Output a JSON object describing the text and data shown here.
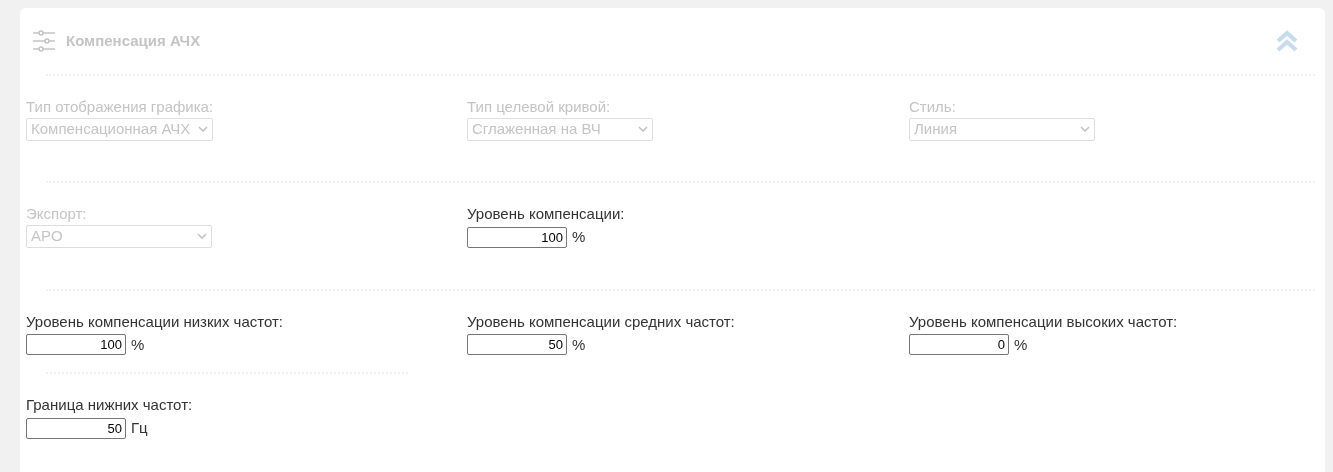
{
  "panel": {
    "title": "Компенсация АЧХ",
    "expanded": true
  },
  "rows": [
    {
      "full_divider": true,
      "fields": [
        {
          "kind": "select",
          "label": "Тип отображения графика:",
          "value": "Компенсационная АЧХ",
          "disabled": true
        },
        {
          "kind": "select",
          "label": "Тип целевой кривой:",
          "value": "Сглаженная на ВЧ",
          "disabled": true
        },
        {
          "kind": "select",
          "label": "Стиль:",
          "value": "Линия",
          "disabled": true
        }
      ]
    },
    {
      "full_divider": true,
      "fields": [
        {
          "kind": "select",
          "label": "Экспорт:",
          "value": "APO",
          "disabled": true
        },
        {
          "kind": "number",
          "label": "Уровень компенсации:",
          "value": "100",
          "unit": "%",
          "disabled": false
        }
      ]
    },
    {
      "full_divider": true,
      "fields": [
        {
          "kind": "number",
          "label": "Уровень компенсации низких частот:",
          "value": "100",
          "unit": "%",
          "disabled": false
        },
        {
          "kind": "number",
          "label": "Уровень компенсации средних частот:",
          "value": "50",
          "unit": "%",
          "disabled": false
        },
        {
          "kind": "number",
          "label": "Уровень компенсации высоких частот:",
          "value": "0",
          "unit": "%",
          "disabled": false
        }
      ]
    },
    {
      "full_divider": false,
      "fields": [
        {
          "kind": "number",
          "label": "Граница нижних частот:",
          "value": "50",
          "unit": "Гц",
          "disabled": false
        }
      ]
    }
  ]
}
